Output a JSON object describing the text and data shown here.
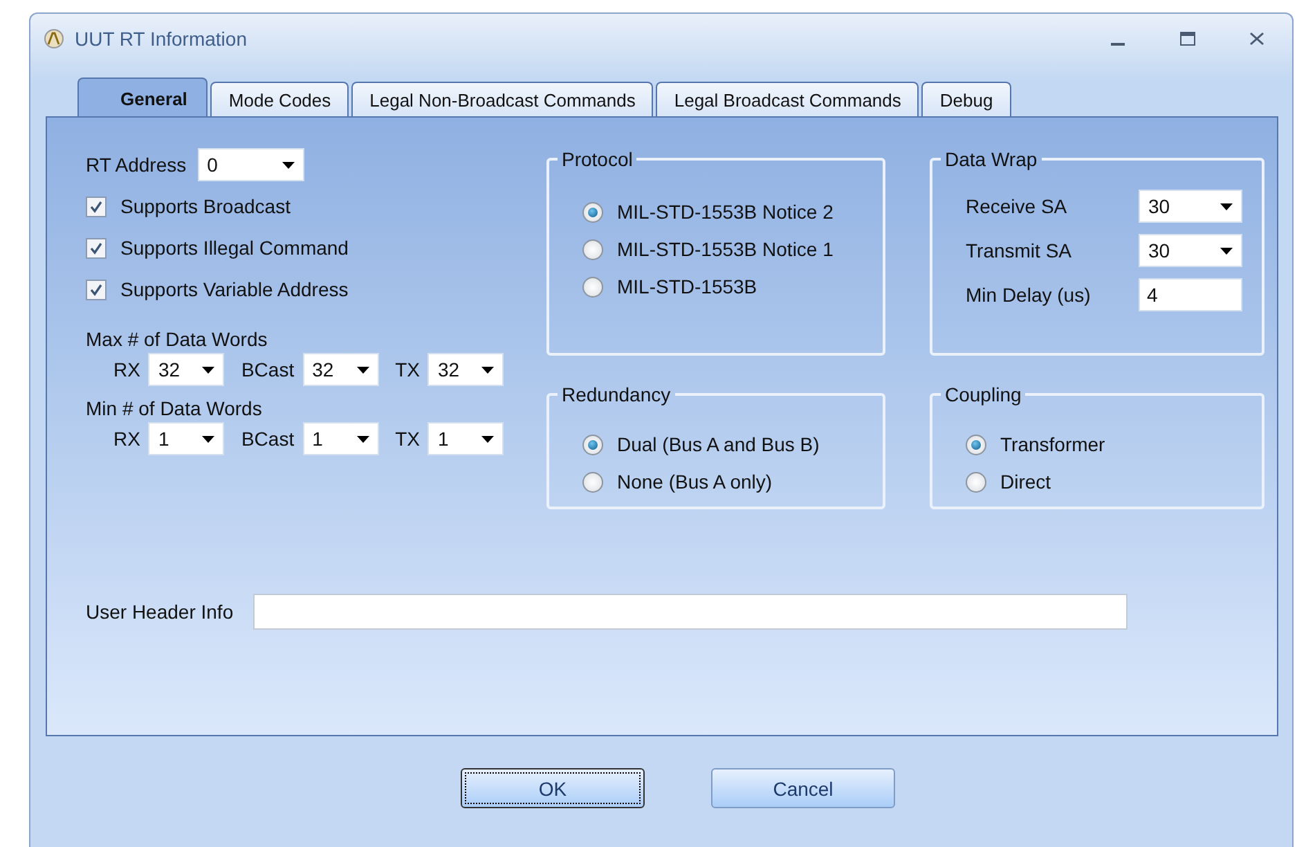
{
  "window": {
    "title": "UUT RT Information"
  },
  "tabs": [
    {
      "label": "General",
      "selected": true
    },
    {
      "label": "Mode Codes",
      "selected": false
    },
    {
      "label": "Legal Non-Broadcast Commands",
      "selected": false
    },
    {
      "label": "Legal Broadcast Commands",
      "selected": false
    },
    {
      "label": "Debug",
      "selected": false
    }
  ],
  "rt_address": {
    "label": "RT Address",
    "value": "0"
  },
  "checkboxes": [
    {
      "label": "Supports Broadcast",
      "checked": true
    },
    {
      "label": "Supports Illegal Command",
      "checked": true
    },
    {
      "label": "Supports Variable Address",
      "checked": true
    }
  ],
  "word_limits": [
    {
      "title": "Max # of Data Words",
      "fields": [
        {
          "label": "RX",
          "value": "32"
        },
        {
          "label": "BCast",
          "value": "32"
        },
        {
          "label": "TX",
          "value": "32"
        }
      ]
    },
    {
      "title": "Min # of Data Words",
      "fields": [
        {
          "label": "RX",
          "value": "1"
        },
        {
          "label": "BCast",
          "value": "1"
        },
        {
          "label": "TX",
          "value": "1"
        }
      ]
    }
  ],
  "protocol": {
    "title": "Protocol",
    "options": [
      {
        "label": "MIL-STD-1553B Notice 2",
        "selected": true
      },
      {
        "label": "MIL-STD-1553B Notice 1",
        "selected": false
      },
      {
        "label": "MIL-STD-1553B",
        "selected": false
      }
    ]
  },
  "data_wrap": {
    "title": "Data Wrap",
    "fields": [
      {
        "label": "Receive SA",
        "value": "30",
        "kind": "dropdown"
      },
      {
        "label": "Transmit SA",
        "value": "30",
        "kind": "dropdown"
      },
      {
        "label": "Min Delay (us)",
        "value": "4",
        "kind": "text"
      }
    ]
  },
  "redundancy": {
    "title": "Redundancy",
    "options": [
      {
        "label": "Dual (Bus A and Bus B)",
        "selected": true
      },
      {
        "label": "None (Bus A only)",
        "selected": false
      }
    ]
  },
  "coupling": {
    "title": "Coupling",
    "options": [
      {
        "label": "Transformer",
        "selected": true
      },
      {
        "label": "Direct",
        "selected": false
      }
    ]
  },
  "user_header": {
    "label": "User Header Info"
  },
  "buttons": [
    {
      "label": "OK",
      "focused": true
    },
    {
      "label": "Cancel",
      "focused": false
    }
  ]
}
